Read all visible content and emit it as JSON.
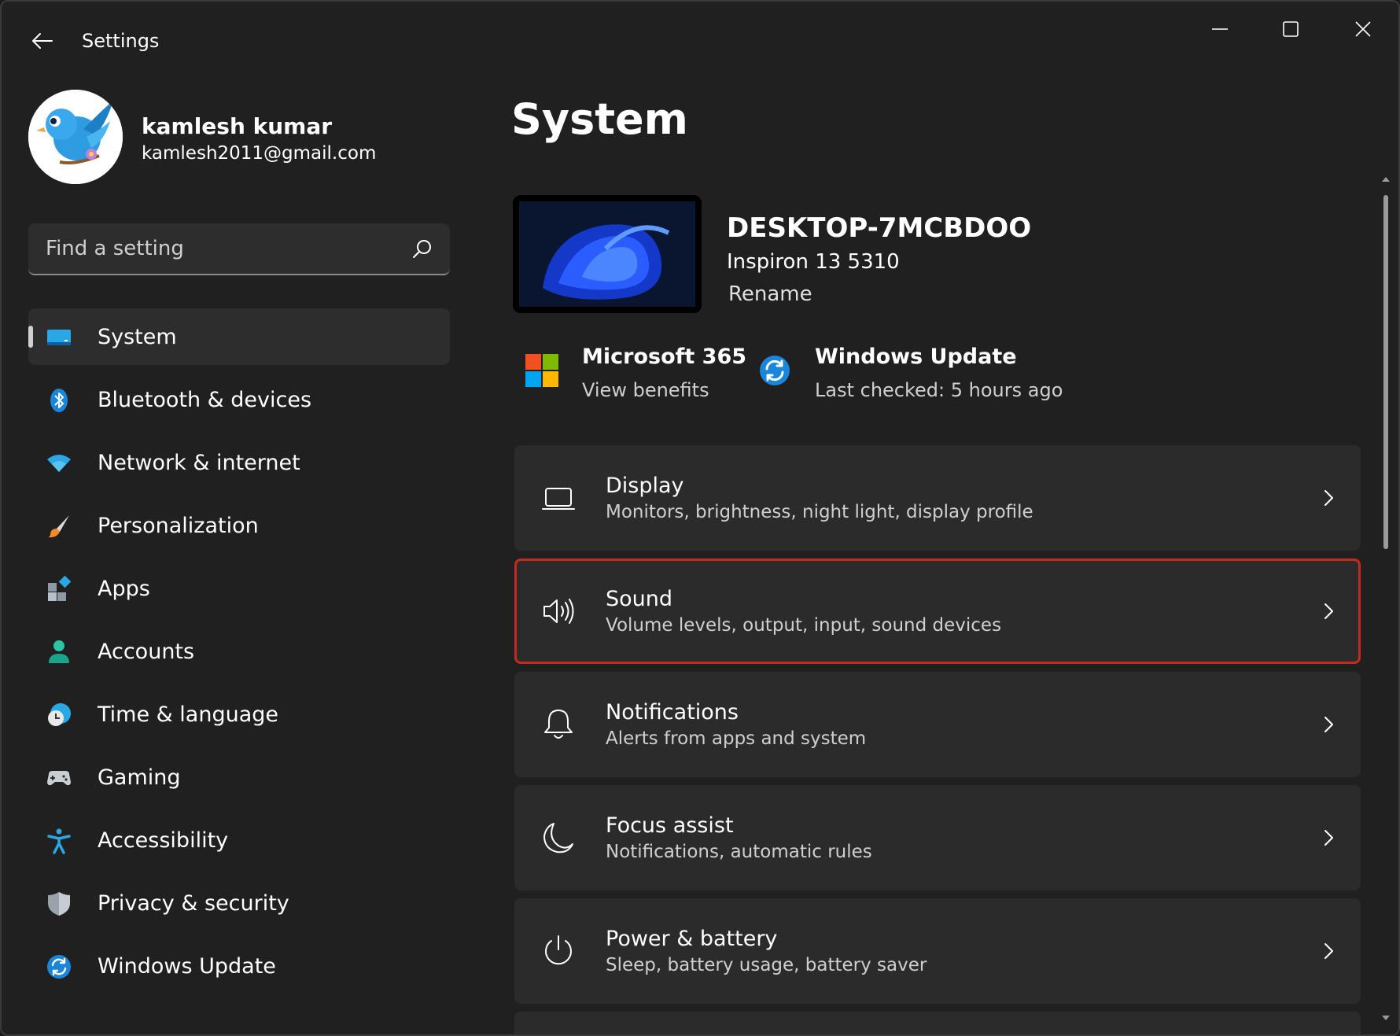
{
  "window": {
    "title": "Settings"
  },
  "profile": {
    "name": "kamlesh kumar",
    "email": "kamlesh2011@gmail.com"
  },
  "search": {
    "placeholder": "Find a setting"
  },
  "sidebar": {
    "items": [
      {
        "label": "System",
        "icon": "system-display-icon",
        "active": true
      },
      {
        "label": "Bluetooth & devices",
        "icon": "bluetooth-icon"
      },
      {
        "label": "Network & internet",
        "icon": "wifi-icon"
      },
      {
        "label": "Personalization",
        "icon": "paintbrush-icon"
      },
      {
        "label": "Apps",
        "icon": "apps-icon"
      },
      {
        "label": "Accounts",
        "icon": "person-icon"
      },
      {
        "label": "Time & language",
        "icon": "clock-globe-icon"
      },
      {
        "label": "Gaming",
        "icon": "gamepad-icon"
      },
      {
        "label": "Accessibility",
        "icon": "accessibility-icon"
      },
      {
        "label": "Privacy & security",
        "icon": "shield-icon"
      },
      {
        "label": "Windows Update",
        "icon": "sync-icon"
      }
    ]
  },
  "main": {
    "title": "System",
    "device": {
      "name": "DESKTOP-7MCBDOO",
      "model": "Inspiron 13 5310",
      "rename_label": "Rename"
    },
    "quick": {
      "ms365_title": "Microsoft 365",
      "ms365_sub": "View benefits",
      "wu_title": "Windows Update",
      "wu_sub": "Last checked: 5 hours ago"
    },
    "cards": [
      {
        "title": "Display",
        "subtitle": "Monitors, brightness, night light, display profile",
        "icon": "laptop-icon"
      },
      {
        "title": "Sound",
        "subtitle": "Volume levels, output, input, sound devices",
        "icon": "speaker-icon",
        "highlighted": true
      },
      {
        "title": "Notifications",
        "subtitle": "Alerts from apps and system",
        "icon": "bell-icon"
      },
      {
        "title": "Focus assist",
        "subtitle": "Notifications, automatic rules",
        "icon": "moon-icon"
      },
      {
        "title": "Power & battery",
        "subtitle": "Sleep, battery usage, battery saver",
        "icon": "power-icon"
      }
    ]
  },
  "colors": {
    "background": "#202020",
    "card": "#2b2b2b",
    "highlight_border": "#c42b1c",
    "accent_blue": "#0078d4"
  }
}
